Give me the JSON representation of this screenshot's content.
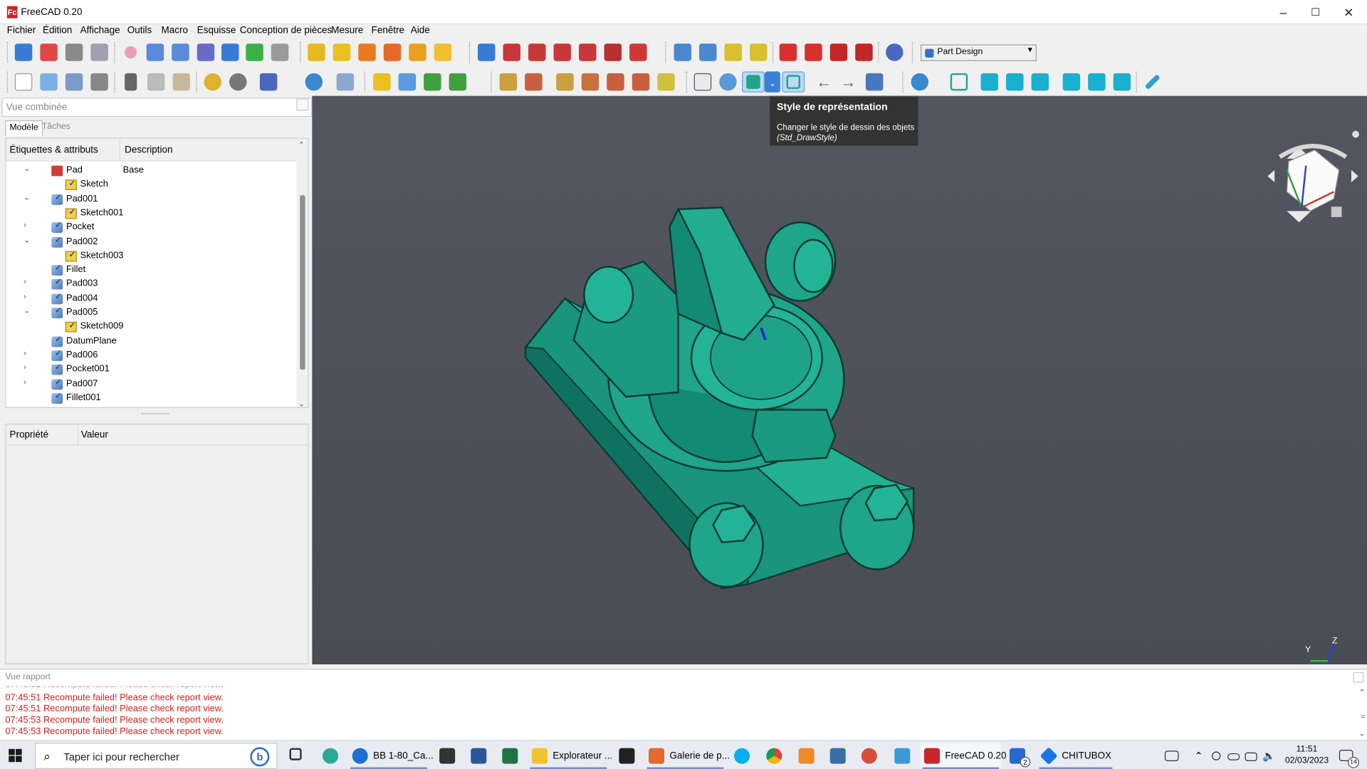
{
  "window": {
    "title": "FreeCAD 0.20",
    "logo": "Fc",
    "minimize": "–",
    "maximize": "☐",
    "close": "✕"
  },
  "menu": [
    "Fichier",
    "Édition",
    "Affichage",
    "Outils",
    "Macro",
    "Esquisse",
    "Conception de pièces",
    "Mesure",
    "Fenêtre",
    "Aide"
  ],
  "workbench": {
    "label": "Part Design",
    "arrow": "▾"
  },
  "combo": {
    "title": "Vue combinée",
    "tabs": [
      "Modèle",
      "Tâches"
    ]
  },
  "tree": {
    "columns": [
      "Étiquettes & attributs",
      "Description"
    ],
    "rows": [
      {
        "label": "Pad",
        "desc": "Base",
        "indent": 0,
        "twisty": "⌄",
        "icon": "error"
      },
      {
        "label": "Sketch",
        "desc": "",
        "indent": 1,
        "twisty": "",
        "icon": "sketch"
      },
      {
        "label": "Pad001",
        "desc": "",
        "indent": 0,
        "twisty": "⌄",
        "icon": "body"
      },
      {
        "label": "Sketch001",
        "desc": "",
        "indent": 1,
        "twisty": "",
        "icon": "sketch"
      },
      {
        "label": "Pocket",
        "desc": "",
        "indent": 0,
        "twisty": "›",
        "icon": "body"
      },
      {
        "label": "Pad002",
        "desc": "",
        "indent": 0,
        "twisty": "⌄",
        "icon": "body"
      },
      {
        "label": "Sketch003",
        "desc": "",
        "indent": 1,
        "twisty": "",
        "icon": "sketch"
      },
      {
        "label": "Fillet",
        "desc": "",
        "indent": 0,
        "twisty": "",
        "icon": "body"
      },
      {
        "label": "Pad003",
        "desc": "",
        "indent": 0,
        "twisty": "›",
        "icon": "body"
      },
      {
        "label": "Pad004",
        "desc": "",
        "indent": 0,
        "twisty": "›",
        "icon": "body"
      },
      {
        "label": "Pad005",
        "desc": "",
        "indent": 0,
        "twisty": "⌄",
        "icon": "body"
      },
      {
        "label": "Sketch009",
        "desc": "",
        "indent": 1,
        "twisty": "",
        "icon": "sketch"
      },
      {
        "label": "DatumPlane",
        "desc": "",
        "indent": 0,
        "twisty": "",
        "icon": "body"
      },
      {
        "label": "Pad006",
        "desc": "",
        "indent": 0,
        "twisty": "›",
        "icon": "body"
      },
      {
        "label": "Pocket001",
        "desc": "",
        "indent": 0,
        "twisty": "›",
        "icon": "body"
      },
      {
        "label": "Pad007",
        "desc": "",
        "indent": 0,
        "twisty": "›",
        "icon": "body"
      },
      {
        "label": "Fillet001",
        "desc": "",
        "indent": 0,
        "twisty": "",
        "icon": "body"
      }
    ]
  },
  "properties": {
    "columns": [
      "Propriété",
      "Valeur"
    ]
  },
  "tooltip": {
    "title": "Style de représentation",
    "body": "Changer le style de dessin des objets",
    "command": "(Std_DrawStyle)"
  },
  "nav_axes": {
    "y": "Y",
    "z": "Z"
  },
  "report": {
    "title": "Vue rapport",
    "lines": [
      "07:45:51  Recompute failed! Please check report view.",
      "07:45:51  Recompute failed! Please check report view.",
      "07:45:53  Recompute failed! Please check report view.",
      "07:45:53  Recompute failed! Please check report view."
    ]
  },
  "taskbar": {
    "search_placeholder": "Taper ici pour rechercher",
    "bing_label": "b",
    "apps": [
      {
        "label": "BB 1-80_Ca...",
        "color": "#1f6fd1"
      },
      {
        "label": "Explorateur ...",
        "color": "#f2c230"
      },
      {
        "label": "Galerie de p...",
        "color": "#e26a2c"
      },
      {
        "label": "FreeCAD 0.20",
        "color": "#c8252c"
      },
      {
        "label": "CHITUBOX",
        "color": "#1877e8"
      }
    ],
    "badge_count": "2",
    "notification_count": "14",
    "time": "11:51",
    "date": "02/03/2023"
  },
  "colors": {
    "model": "#1fa58a",
    "model_dark": "#0f6e5c",
    "viewport": "#4f5159",
    "error_text": "#e01b1b"
  }
}
